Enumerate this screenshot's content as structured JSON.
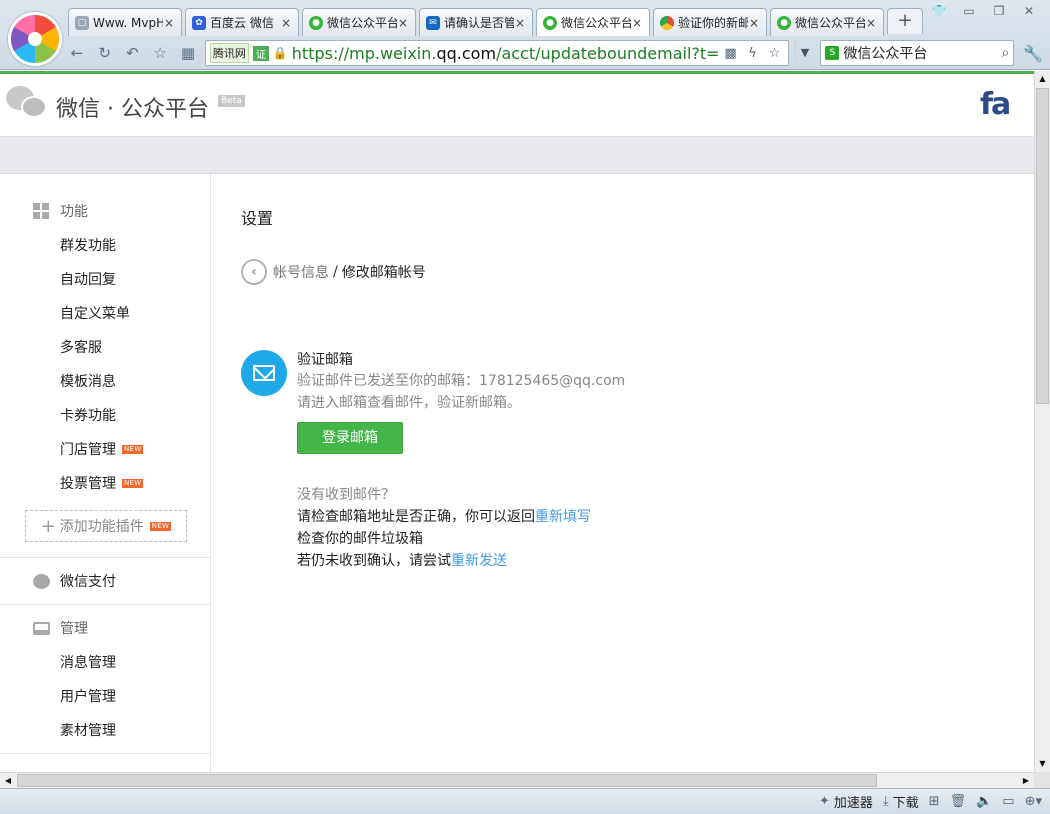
{
  "browser": {
    "tabs": [
      {
        "title": "Www. MvpHack",
        "icon": "page-icon",
        "color": "#9aa7b4"
      },
      {
        "title": "百度云 微信",
        "icon": "baidu-paw-icon",
        "color": "#2f62d9"
      },
      {
        "title": "微信公众平台",
        "icon": "wechat-icon",
        "color": "#35b53a"
      },
      {
        "title": "请确认是否管",
        "icon": "mail-icon",
        "color": "#1767c4"
      },
      {
        "title": "微信公众平台",
        "icon": "wechat-icon",
        "color": "#35b53a",
        "active": true
      },
      {
        "title": "验证你的新邮",
        "icon": "chrome-icon",
        "color": "#e04a3a"
      },
      {
        "title": "微信公众平台",
        "icon": "wechat-icon",
        "color": "#35b53a"
      }
    ],
    "tab_close": "×",
    "new_tab": "+",
    "address": {
      "brand": "腾讯网",
      "cert": "证",
      "url_prefix": "https://mp.weixin.",
      "url_domain": "qq.com",
      "url_suffix": "/acct/updateboundemail?t=s"
    },
    "search": {
      "value": "微信公众平台"
    }
  },
  "header": {
    "title": "微信 · 公众平台",
    "beta": "Beta",
    "avatar_text": "fa"
  },
  "sidebar": {
    "function_title": "功能",
    "function_items": [
      {
        "label": "群发功能",
        "new": false
      },
      {
        "label": "自动回复",
        "new": false
      },
      {
        "label": "自定义菜单",
        "new": false
      },
      {
        "label": "多客服",
        "new": false
      },
      {
        "label": "模板消息",
        "new": false
      },
      {
        "label": "卡券功能",
        "new": false
      },
      {
        "label": "门店管理",
        "new": true
      },
      {
        "label": "投票管理",
        "new": true
      }
    ],
    "new_badge": "NEW",
    "add_plugin": "添加功能插件",
    "pay_title": "微信支付",
    "manage_title": "管理",
    "manage_items": [
      "消息管理",
      "用户管理",
      "素材管理"
    ]
  },
  "main": {
    "title": "设置",
    "breadcrumb_link": "帐号信息",
    "breadcrumb_sep": "/",
    "breadcrumb_current": "修改邮箱帐号",
    "verify_title": "验证邮箱",
    "verify_sent": "验证邮件已发送至你的邮箱：178125465@qq.com",
    "verify_hint": "请进入邮箱查看邮件，验证新邮箱。",
    "login_button": "登录邮箱",
    "help_question": "没有收到邮件？",
    "help_line1_text": "请检查邮箱地址是否正确，你可以返回",
    "help_line1_link": "重新填写",
    "help_line2": "检查你的邮件垃圾箱",
    "help_line3_text": "若仍未收到确认，请尝试",
    "help_line3_link": "重新发送"
  },
  "statusbar": {
    "accelerator": "加速器",
    "download": "下载"
  },
  "colors": {
    "accent_green": "#44b549",
    "link_blue": "#459ae9",
    "mail_blue": "#1fa9e9"
  }
}
